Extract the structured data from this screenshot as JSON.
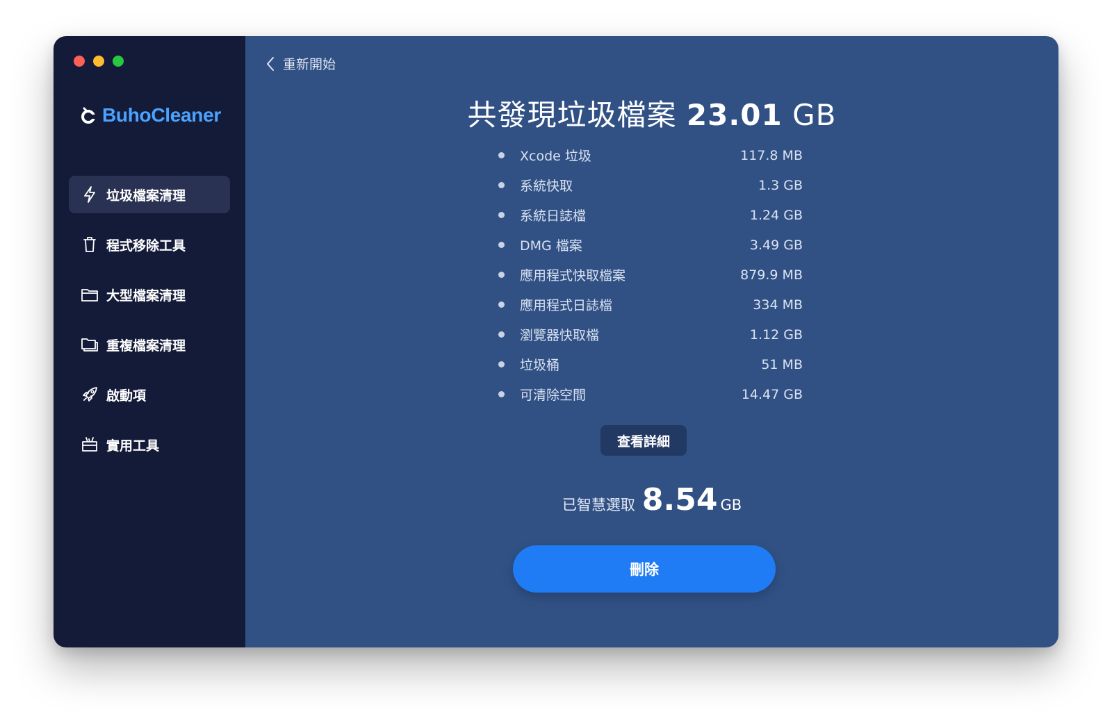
{
  "window": {
    "traffic_colors": [
      "#fe5f57",
      "#febc2e",
      "#28c840"
    ]
  },
  "brand": {
    "name": "BuhoCleaner",
    "color": "#4ba3ff"
  },
  "sidebar": {
    "items": [
      {
        "label": "垃圾檔案清理",
        "icon": "lightning-icon",
        "active": true
      },
      {
        "label": "程式移除工具",
        "icon": "trash-icon",
        "active": false
      },
      {
        "label": "大型檔案清理",
        "icon": "folder-icon",
        "active": false
      },
      {
        "label": "重複檔案清理",
        "icon": "duplicate-folder-icon",
        "active": false
      },
      {
        "label": "啟動項",
        "icon": "rocket-icon",
        "active": false
      },
      {
        "label": "實用工具",
        "icon": "toolbox-icon",
        "active": false
      }
    ]
  },
  "header": {
    "back_label": "重新開始"
  },
  "summary": {
    "title_prefix": "共發現垃圾檔案",
    "total_value": "23.01",
    "total_unit": "GB"
  },
  "junk_items": [
    {
      "label": "Xcode 垃圾",
      "size": "117.8 MB"
    },
    {
      "label": "系統快取",
      "size": "1.3 GB"
    },
    {
      "label": "系統日誌檔",
      "size": "1.24 GB"
    },
    {
      "label": "DMG 檔案",
      "size": "3.49 GB"
    },
    {
      "label": "應用程式快取檔案",
      "size": "879.9 MB"
    },
    {
      "label": "應用程式日誌檔",
      "size": "334 MB"
    },
    {
      "label": "瀏覽器快取檔",
      "size": "1.12 GB"
    },
    {
      "label": "垃圾桶",
      "size": "51 MB"
    },
    {
      "label": "可清除空間",
      "size": "14.47 GB"
    }
  ],
  "actions": {
    "details_label": "查看詳細",
    "selected_label": "已智慧選取",
    "selected_value": "8.54",
    "selected_unit": "GB",
    "delete_label": "刪除"
  },
  "colors": {
    "sidebar_bg": "#141b39",
    "main_bg": "#315185",
    "accent": "#1f7cf5"
  }
}
